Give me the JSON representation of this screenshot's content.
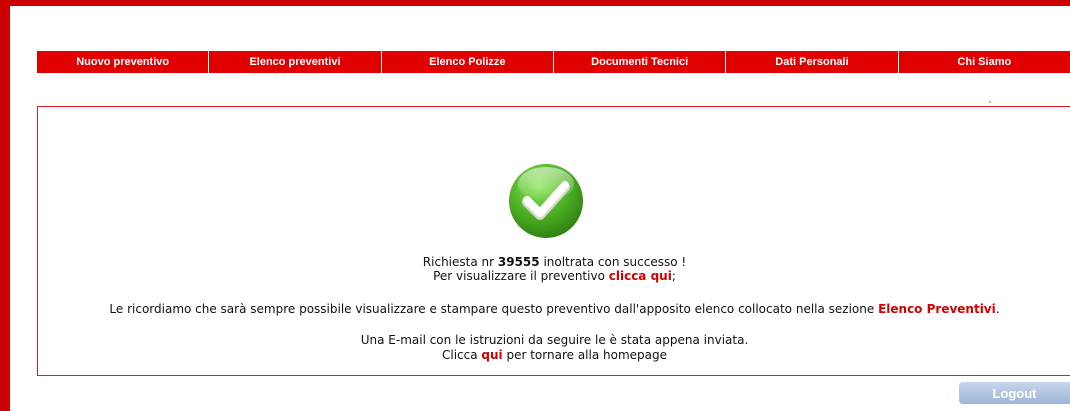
{
  "nav": {
    "items": [
      {
        "label": "Nuovo preventivo"
      },
      {
        "label": "Elenco preventivi"
      },
      {
        "label": "Elenco Polizze"
      },
      {
        "label": "Documenti Tecnici"
      },
      {
        "label": "Dati Personali"
      },
      {
        "label": "Chi Siamo"
      }
    ]
  },
  "result": {
    "icon": "checkmark-success-icon",
    "line1_prefix": "Richiesta nr ",
    "request_number": "39555",
    "line1_suffix": " inoltrata con successo !",
    "line2_prefix": "Per visualizzare il preventivo ",
    "line2_link": "clicca qui",
    "line2_suffix": ";",
    "reminder_prefix": "Le ricordiamo che sarà sempre possibile visualizzare e stampare questo preventivo dall'apposito elenco collocato nella sezione ",
    "reminder_link": "Elenco Preventivi",
    "reminder_suffix": ".",
    "email_notice": "Una E-mail con le istruzioni da seguire le è stata appena inviata.",
    "home_prefix": "Clicca ",
    "home_link": "qui",
    "home_suffix": " per tornare alla homepage"
  },
  "logout": {
    "label": "Logout"
  },
  "colors": {
    "brand_red": "#e00000",
    "success_green": "#4caf22",
    "logout_blue": "#9eb5d6"
  }
}
